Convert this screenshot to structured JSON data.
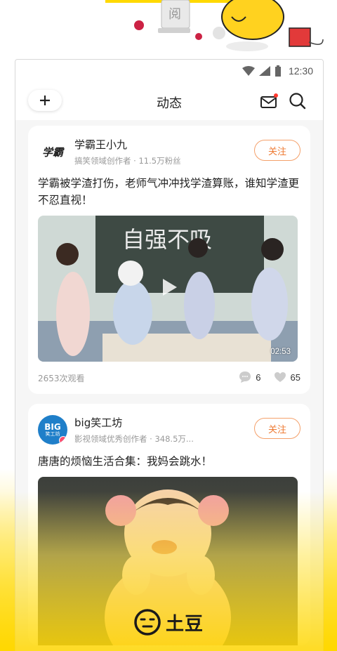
{
  "statusbar": {
    "time": "12:30"
  },
  "header": {
    "title": "动态"
  },
  "posts": [
    {
      "author_name": "学霸王小九",
      "avatar_text": "学霸",
      "author_meta": "搞笑领域创作者 · 11.5万粉丝",
      "follow_label": "关注",
      "text": "学霸被学渣打伤，老师气冲冲找学渣算账，谁知学渣更不忍直视！",
      "video_blackboard_text": "自强不吸",
      "duration": "02:53",
      "views": "2653次观看",
      "comments": "6",
      "likes": "65"
    },
    {
      "author_name": "big笑工坊",
      "avatar_text": "BIG",
      "avatar_subtext": "笑工坊",
      "author_meta": "影视领域优秀创作者 · 348.5万...",
      "follow_label": "关注",
      "text": "唐唐的烦恼生活合集：我妈会跳水！"
    }
  ],
  "brand": {
    "name": "土豆"
  },
  "colors": {
    "accent": "#ee7a33",
    "brand_yellow": "#ffd900",
    "notification_dot": "#ff3b30"
  }
}
